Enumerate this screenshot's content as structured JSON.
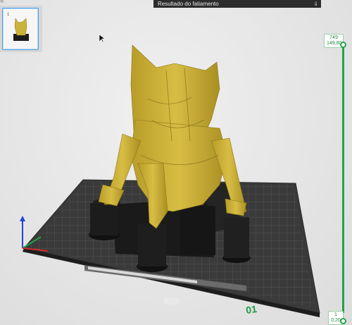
{
  "window": {
    "top_left_icon": "⟲"
  },
  "plates": {
    "thumbnails": [
      {
        "index": "1",
        "selected": true
      }
    ]
  },
  "slicing_result": {
    "title": "Resultado do fatiamento",
    "expand_icon": "double-chevron-down-icon"
  },
  "layer_slider": {
    "top_layer": "749",
    "top_height": "149,80",
    "bottom_layer": "1",
    "bottom_height": "0,20",
    "color": "#23a34a"
  },
  "build_plate": {
    "plate_number": "01",
    "model_color": "#cdb23a",
    "support_color": "#1c1c1c"
  }
}
